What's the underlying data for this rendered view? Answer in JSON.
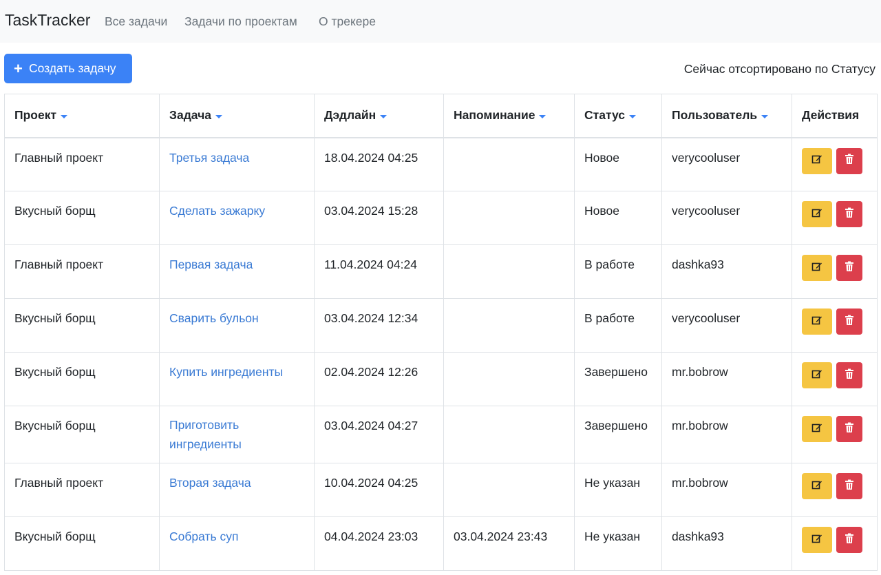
{
  "navbar": {
    "brand": "TaskTracker",
    "links": [
      "Все задачи",
      "Задачи по проектам",
      "О трекере"
    ]
  },
  "toolbar": {
    "create_label": "Создать задачу",
    "sort_note": "Сейчас отсортировано по Статусу"
  },
  "table": {
    "columns": [
      "Проект",
      "Задача",
      "Дэдлайн",
      "Напоминание",
      "Статус",
      "Пользователь",
      "Действия"
    ],
    "rows": [
      {
        "project": "Главный проект",
        "task": "Третья задача",
        "deadline": "18.04.2024 04:25",
        "reminder": "",
        "status": "Новое",
        "user": "verycooluser"
      },
      {
        "project": "Вкусный борщ",
        "task": "Сделать зажарку",
        "deadline": "03.04.2024 15:28",
        "reminder": "",
        "status": "Новое",
        "user": "verycooluser"
      },
      {
        "project": "Главный проект",
        "task": "Первая задача",
        "deadline": "11.04.2024 04:24",
        "reminder": "",
        "status": "В работе",
        "user": "dashka93"
      },
      {
        "project": "Вкусный борщ",
        "task": "Сварить бульон",
        "deadline": "03.04.2024 12:34",
        "reminder": "",
        "status": "В работе",
        "user": "verycooluser"
      },
      {
        "project": "Вкусный борщ",
        "task": "Купить ингредиенты",
        "deadline": "02.04.2024 12:26",
        "reminder": "",
        "status": "Завершено",
        "user": "mr.bobrow"
      },
      {
        "project": "Вкусный борщ",
        "task": "Приготовить ингредиенты",
        "deadline": "03.04.2024 04:27",
        "reminder": "",
        "status": "Завершено",
        "user": "mr.bobrow"
      },
      {
        "project": "Главный проект",
        "task": "Вторая задача",
        "deadline": "10.04.2024 04:25",
        "reminder": "",
        "status": "Не указан",
        "user": "mr.bobrow"
      },
      {
        "project": "Вкусный борщ",
        "task": "Собрать суп",
        "deadline": "04.04.2024 23:03",
        "reminder": "03.04.2024 23:43",
        "status": "Не указан",
        "user": "dashka93"
      }
    ]
  },
  "icons": {
    "create": "plus-icon",
    "sort": "caret-down-icon",
    "edit": "edit-icon",
    "delete": "trash-icon"
  },
  "colors": {
    "primary": "#3b82f6",
    "link": "#3b7bd4",
    "warning": "#f5c542",
    "danger": "#dc3f4c"
  }
}
